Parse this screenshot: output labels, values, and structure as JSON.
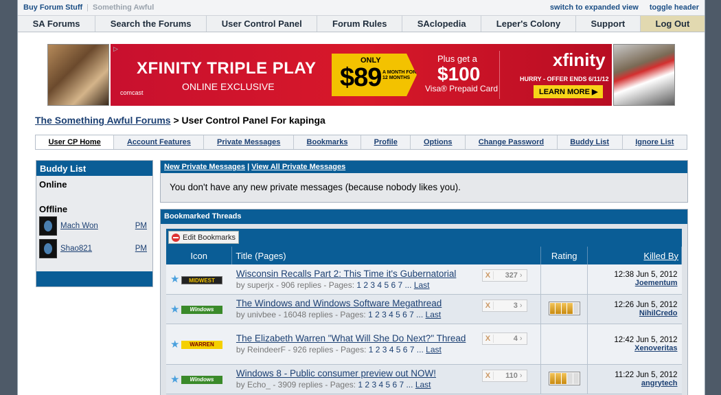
{
  "topbar": {
    "buy_forum_stuff": "Buy Forum Stuff",
    "something_awful": "Something Awful",
    "switch_view": "switch to expanded view",
    "toggle_header": "toggle header"
  },
  "nav": {
    "items": [
      "SA Forums",
      "Search the Forums",
      "User Control Panel",
      "Forum Rules",
      "SAclopedia",
      "Leper's Colony",
      "Support",
      "Log Out"
    ]
  },
  "ad": {
    "title": "XFINITY TRIPLE PLAY",
    "subtitle": "ONLINE EXCLUSIVE",
    "brand_small": "comcast",
    "only": "ONLY",
    "price": "$89",
    "month_text": "A MONTH FOR 12 MONTHS",
    "plus_get": "Plus get a",
    "hundred": "$100",
    "visa": "Visa® Prepaid Card",
    "brand": "xfinity",
    "hurry": "HURRY - OFFER ENDS 6/11/12",
    "learn_more": "LEARN MORE ▶"
  },
  "breadcrumb": {
    "root": "The Something Awful Forums",
    "sep": " > ",
    "current": "User Control Panel For kapinga"
  },
  "tabs": [
    "User CP Home",
    "Account Features",
    "Private Messages",
    "Bookmarks",
    "Profile",
    "Options",
    "Change Password",
    "Buddy List",
    "Ignore List"
  ],
  "buddy_list": {
    "title": "Buddy List",
    "online_label": "Online",
    "offline_label": "Offline",
    "offline": [
      {
        "name": "Mach Won",
        "pm": "PM"
      },
      {
        "name": "Shao821",
        "pm": "PM"
      }
    ]
  },
  "private_messages": {
    "new_link": "New Private Messages",
    "sep": " | ",
    "all_link": "View All Private Messages",
    "message": "You don't have any new private messages (because nobody likes you)."
  },
  "bookmarks": {
    "title": "Bookmarked Threads",
    "edit_button": "Edit Bookmarks",
    "columns": {
      "icon": "Icon",
      "title": "Title (Pages)",
      "rating": "Rating",
      "killed_by": "Killed By"
    },
    "threads": [
      {
        "icon_label": "MIDWEST",
        "icon_type": "midwest",
        "title": "Wisconsin Recalls Part 2: This Time it's Gubernatorial",
        "by": "by",
        "author": "superjx",
        "replies": "906",
        "replies_label": "replies - Pages:",
        "pages": "1 2 3 4 5 6 7 ...",
        "last": "Last",
        "unread": "327",
        "x": "X",
        "rating": null,
        "killed_time": "12:38 Jun 5, 2012",
        "killed_by": "Joementum"
      },
      {
        "icon_label": "Windows",
        "icon_type": "windows",
        "title": "The Windows and Windows Software Megathread",
        "by": "by",
        "author": "univbee",
        "replies": "16048",
        "replies_label": "replies - Pages:",
        "pages": "1 2 3 4 5 6 7 ...",
        "last": "Last",
        "unread": "3",
        "x": "X",
        "rating": 4,
        "killed_time": "12:26 Jun 5, 2012",
        "killed_by": "NihilCredo"
      },
      {
        "icon_label": "WARREN",
        "icon_type": "warren",
        "title": "The Elizabeth Warren \"What Will She Do Next?\" Thread",
        "by": "by",
        "author": "ReindeerF",
        "replies": "926",
        "replies_label": "replies - Pages:",
        "pages": "1 2 3 4 5 6 7 ...",
        "last": "Last",
        "unread": "4",
        "x": "X",
        "rating": null,
        "killed_time": "12:42 Jun 5, 2012",
        "killed_by": "Xenoveritas"
      },
      {
        "icon_label": "Windows",
        "icon_type": "windows",
        "title": "Windows 8 - Public consumer preview out NOW!",
        "by": "by",
        "author": "Echo_",
        "replies": "3909",
        "replies_label": "replies - Pages:",
        "pages": "1 2 3 4 5 6 7 ...",
        "last": "Last",
        "unread": "110",
        "x": "X",
        "rating": 3,
        "killed_time": "11:22 Jun 5, 2012",
        "killed_by": "angrytech"
      }
    ]
  }
}
